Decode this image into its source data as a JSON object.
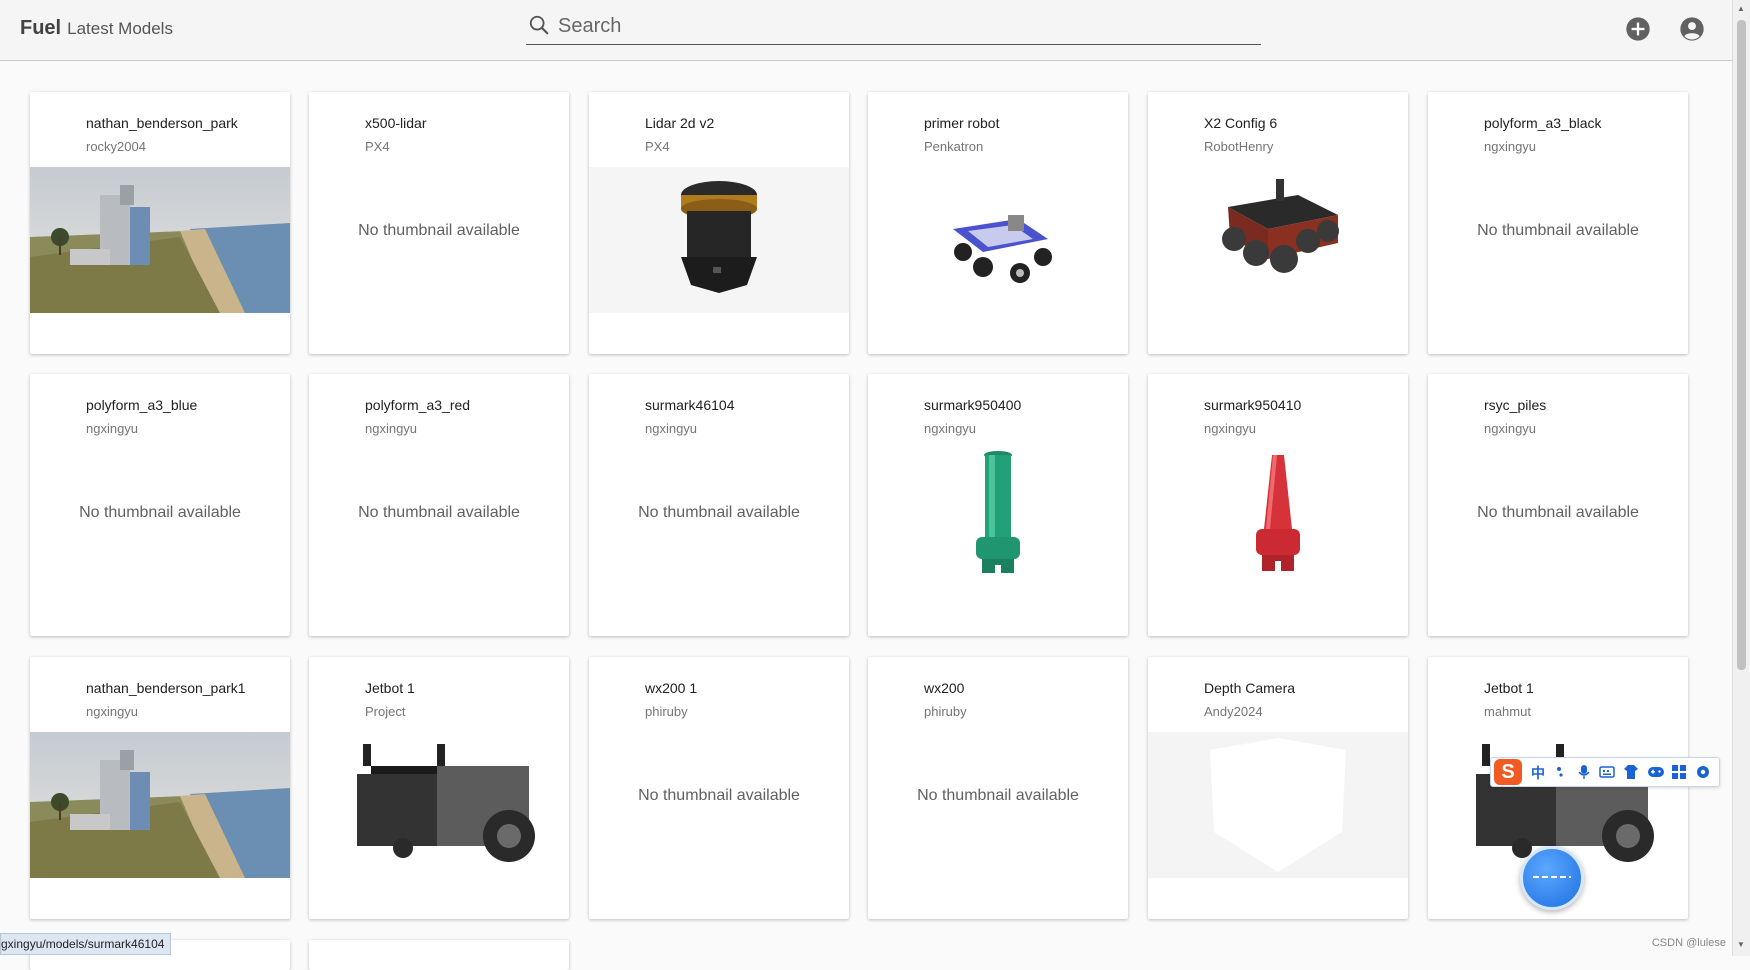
{
  "header": {
    "brand": "Fuel",
    "subtitle": "Latest Models",
    "search_placeholder": "Search"
  },
  "no_thumb_text": "No thumbnail available",
  "cards": [
    {
      "title": "nathan_benderson_park",
      "owner": "rocky2004",
      "thumb": "park-scene-image"
    },
    {
      "title": "x500-lidar",
      "owner": "PX4",
      "thumb": "none"
    },
    {
      "title": "Lidar 2d v2",
      "owner": "PX4",
      "thumb": "lidar-sensor-image"
    },
    {
      "title": "primer robot",
      "owner": "Penkatron",
      "thumb": "blue-robot-image"
    },
    {
      "title": "X2 Config 6",
      "owner": "RobotHenry",
      "thumb": "rover-image"
    },
    {
      "title": "polyform_a3_black",
      "owner": "ngxingyu",
      "thumb": "none"
    },
    {
      "title": "polyform_a3_blue",
      "owner": "ngxingyu",
      "thumb": "none"
    },
    {
      "title": "polyform_a3_red",
      "owner": "ngxingyu",
      "thumb": "none"
    },
    {
      "title": "surmark46104",
      "owner": "ngxingyu",
      "thumb": "none"
    },
    {
      "title": "surmark950400",
      "owner": "ngxingyu",
      "thumb": "green-buoy-image"
    },
    {
      "title": "surmark950410",
      "owner": "ngxingyu",
      "thumb": "red-buoy-image"
    },
    {
      "title": "rsyc_piles",
      "owner": "ngxingyu",
      "thumb": "none"
    },
    {
      "title": "nathan_benderson_park1",
      "owner": "ngxingyu",
      "thumb": "park-scene-image"
    },
    {
      "title": "Jetbot 1",
      "owner": "Project",
      "thumb": "jetbot-image"
    },
    {
      "title": "wx200 1",
      "owner": "phiruby",
      "thumb": "none"
    },
    {
      "title": "wx200",
      "owner": "phiruby",
      "thumb": "none"
    },
    {
      "title": "Depth Camera",
      "owner": "Andy2024",
      "thumb": "camera-placeholder-image"
    },
    {
      "title": "Jetbot 1",
      "owner": "mahmut",
      "thumb": "jetbot-image"
    }
  ],
  "status_url": "gxingyu/models/surmark46104",
  "watermark": "CSDN @lulese",
  "ime": {
    "logo": "S",
    "mode": "中"
  }
}
